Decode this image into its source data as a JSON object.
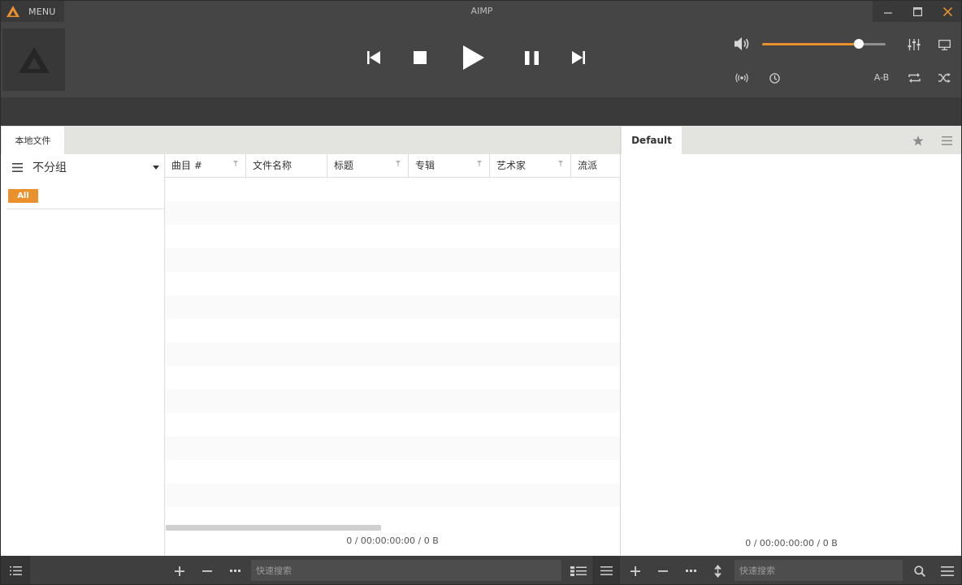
{
  "window": {
    "title": "AIMP",
    "menu_label": "MENU"
  },
  "player": {
    "volume_percent": 78
  },
  "left_pane": {
    "tab_label": "本地文件",
    "group_label": "不分组",
    "all_badge": "All",
    "columns": [
      "曲目 #",
      "文件名称",
      "标题",
      "专辑",
      "艺术家",
      "流派"
    ],
    "status": "0 / 00:00:00:00 / 0 B"
  },
  "right_pane": {
    "tab_label": "Default",
    "status": "0 / 00:00:00:00 / 0 B"
  },
  "bottom": {
    "left_search_placeholder": "快速搜索",
    "right_search_placeholder": "快速搜索"
  },
  "colors": {
    "accent": "#e8912d",
    "title_bar": "#454545",
    "bottom_bar": "#3f3f3f"
  },
  "ab_label": "A-B"
}
